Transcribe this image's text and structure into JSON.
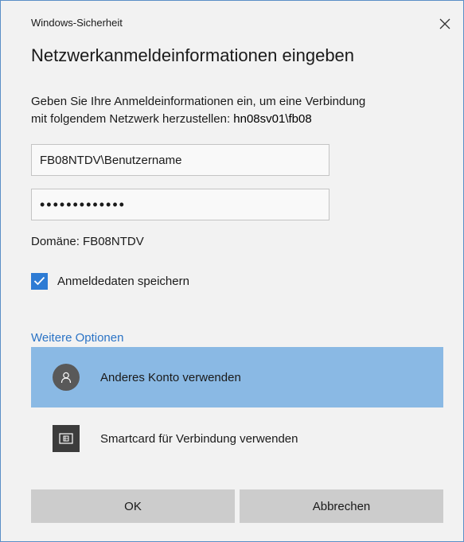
{
  "window": {
    "app_title": "Windows-Sicherheit",
    "close_icon": "close-icon"
  },
  "dialog": {
    "heading": "Netzwerkanmeldeinformationen eingeben",
    "description_line1": "Geben Sie Ihre Anmeldeinformationen ein, um eine Verbindung",
    "description_line2_prefix": "mit folgendem Netzwerk herzustellen: ",
    "network_name": "hn08sv01\\fb08"
  },
  "form": {
    "username_value": "FB08NTDV\\Benutzername",
    "password_value": "•••••••••••••",
    "domain_text": "Domäne: FB08NTDV",
    "remember": {
      "label": "Anmeldedaten speichern",
      "checked": true,
      "accent_color": "#2d7bd4"
    }
  },
  "more_options": {
    "label": "Weitere Optionen",
    "link_color": "#2a73c5",
    "items": [
      {
        "label": "Anderes Konto verwenden",
        "icon": "person-icon",
        "selected": true,
        "highlight_color": "#8ab9e4"
      },
      {
        "label": "Smartcard für Verbindung verwenden",
        "icon": "smartcard-icon",
        "selected": false
      }
    ]
  },
  "buttons": {
    "ok_label": "OK",
    "cancel_label": "Abbrechen"
  }
}
